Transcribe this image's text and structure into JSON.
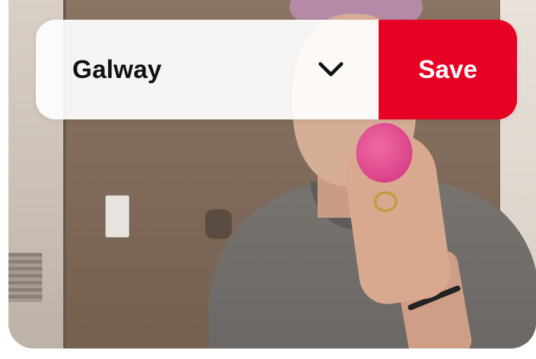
{
  "board_picker": {
    "selected_board": "Galway",
    "dropdown_icon": "chevron-down-icon"
  },
  "save_button": {
    "label": "Save"
  },
  "colors": {
    "save_red": "#e60023",
    "picker_background": "#ffffff",
    "text_dark": "#111111"
  }
}
